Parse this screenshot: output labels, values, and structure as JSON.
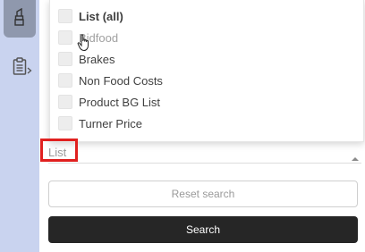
{
  "sidebar": {
    "items": [
      {
        "icon": "lipstick-icon",
        "active": true
      },
      {
        "icon": "clipboard-icon",
        "active": false
      }
    ]
  },
  "dropdown": {
    "options": [
      {
        "label": "List (all)",
        "checked": false
      },
      {
        "label": "Bidfood",
        "checked": false
      },
      {
        "label": "Brakes",
        "checked": false
      },
      {
        "label": "Non Food Costs",
        "checked": false
      },
      {
        "label": "Product BG List",
        "checked": false
      },
      {
        "label": "Turner Price",
        "checked": false
      }
    ]
  },
  "filter": {
    "list_label": "List"
  },
  "buttons": {
    "reset_label": "Reset search",
    "search_label": "Search"
  },
  "colors": {
    "sidebar_bg": "#c9d3ef",
    "sidebar_active": "#8f98ad",
    "highlight": "#e0201f",
    "search_bg": "#262626"
  }
}
